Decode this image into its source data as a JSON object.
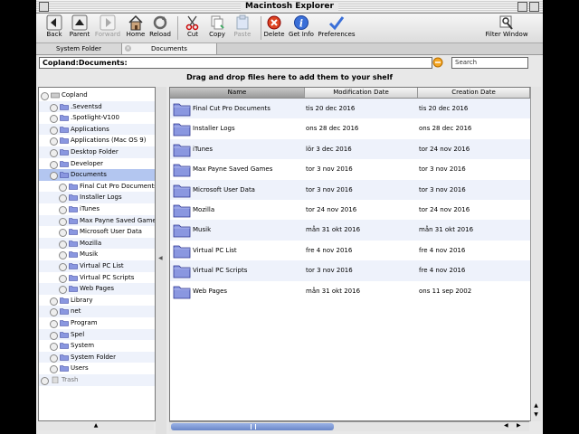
{
  "window": {
    "title": "Macintosh Explorer"
  },
  "toolbar": {
    "back": "Back",
    "parent": "Parent",
    "forward": "Forward",
    "home": "Home",
    "reload": "Reload",
    "cut": "Cut",
    "copy": "Copy",
    "paste": "Paste",
    "delete": "Delete",
    "get_info": "Get Info",
    "preferences": "Preferences",
    "filter": "Filter Window"
  },
  "tabs": {
    "system_folder": "System Folder",
    "documents": "Documents"
  },
  "pathbar": {
    "path": "Copland:Documents:",
    "search_placeholder": "Search"
  },
  "shelf": {
    "text": "Drag and drop files here to add them to your shelf"
  },
  "columns": {
    "name": "Name",
    "modified": "Modification Date",
    "created": "Creation Date"
  },
  "tree": [
    {
      "label": "Copland",
      "level": 0,
      "icon": "disk-icon"
    },
    {
      "label": ".Seventsd",
      "level": 1,
      "icon": "folder-icon"
    },
    {
      "label": ".Spotlight-V100",
      "level": 1,
      "icon": "folder-icon"
    },
    {
      "label": "Applications",
      "level": 1,
      "icon": "folder-icon"
    },
    {
      "label": "Applications (Mac OS 9)",
      "level": 1,
      "icon": "folder-icon"
    },
    {
      "label": "Desktop Folder",
      "level": 1,
      "icon": "folder-icon"
    },
    {
      "label": "Developer",
      "level": 1,
      "icon": "folder-icon"
    },
    {
      "label": "Documents",
      "level": 1,
      "icon": "folder-icon",
      "selected": true
    },
    {
      "label": "Final Cut Pro Documents",
      "level": 2,
      "icon": "folder-icon"
    },
    {
      "label": "Installer Logs",
      "level": 2,
      "icon": "folder-icon"
    },
    {
      "label": "iTunes",
      "level": 2,
      "icon": "folder-icon"
    },
    {
      "label": "Max Payne Saved Games",
      "level": 2,
      "icon": "folder-icon"
    },
    {
      "label": "Microsoft User Data",
      "level": 2,
      "icon": "folder-icon"
    },
    {
      "label": "Mozilla",
      "level": 2,
      "icon": "folder-icon"
    },
    {
      "label": "Musik",
      "level": 2,
      "icon": "folder-icon"
    },
    {
      "label": "Virtual PC List",
      "level": 2,
      "icon": "folder-icon"
    },
    {
      "label": "Virtual PC Scripts",
      "level": 2,
      "icon": "folder-icon"
    },
    {
      "label": "Web Pages",
      "level": 2,
      "icon": "folder-icon"
    },
    {
      "label": "Library",
      "level": 1,
      "icon": "folder-icon"
    },
    {
      "label": "net",
      "level": 1,
      "icon": "folder-icon"
    },
    {
      "label": "Program",
      "level": 1,
      "icon": "folder-icon"
    },
    {
      "label": "Spel",
      "level": 1,
      "icon": "folder-icon"
    },
    {
      "label": "System",
      "level": 1,
      "icon": "folder-icon"
    },
    {
      "label": "System Folder",
      "level": 1,
      "icon": "folder-icon"
    },
    {
      "label": "Users",
      "level": 1,
      "icon": "folder-icon"
    },
    {
      "label": "Trash",
      "level": 0,
      "icon": "trash-icon",
      "dim": true
    }
  ],
  "files": [
    {
      "name": "Final Cut Pro Documents",
      "modified": "tis 20 dec 2016",
      "created": "tis 20 dec 2016"
    },
    {
      "name": "Installer Logs",
      "modified": "ons 28 dec 2016",
      "created": "ons 28 dec 2016"
    },
    {
      "name": "iTunes",
      "modified": "lör 3 dec 2016",
      "created": "tor 24 nov 2016"
    },
    {
      "name": "Max Payne Saved Games",
      "modified": "tor 3 nov 2016",
      "created": "tor 3 nov 2016"
    },
    {
      "name": "Microsoft User Data",
      "modified": "tor 3 nov 2016",
      "created": "tor 3 nov 2016"
    },
    {
      "name": "Mozilla",
      "modified": "tor 24 nov 2016",
      "created": "tor 24 nov 2016"
    },
    {
      "name": "Musik",
      "modified": "mån 31 okt 2016",
      "created": "mån 31 okt 2016"
    },
    {
      "name": "Virtual PC List",
      "modified": "fre 4 nov 2016",
      "created": "fre 4 nov 2016"
    },
    {
      "name": "Virtual PC Scripts",
      "modified": "tor 3 nov 2016",
      "created": "fre 4 nov 2016"
    },
    {
      "name": "Web Pages",
      "modified": "mån 31 okt 2016",
      "created": "ons 11 sep 2002"
    }
  ],
  "colors": {
    "selection": "#b3c6f0",
    "stripe": "#eef2fb",
    "folder": "#8a97e0"
  }
}
